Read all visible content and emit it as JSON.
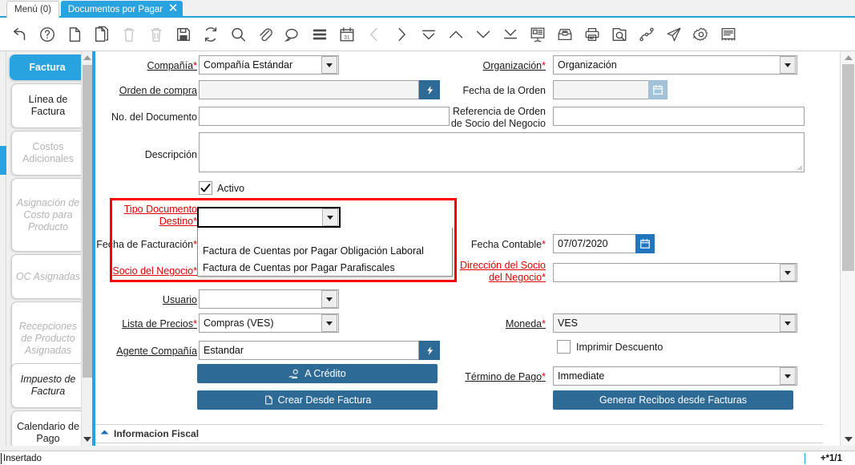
{
  "window": {
    "tabs": [
      {
        "label": "Menú (0)",
        "active": false,
        "closable": false
      },
      {
        "label": "Documentos por Pagar",
        "active": true,
        "closable": true
      }
    ]
  },
  "toolbar": {
    "buttons": [
      {
        "name": "undo-icon",
        "title": "Deshacer",
        "enabled": true
      },
      {
        "name": "help-icon",
        "title": "Ayuda",
        "enabled": true
      },
      {
        "name": "new-record-icon",
        "title": "Nuevo Registro",
        "enabled": true
      },
      {
        "name": "copy-record-icon",
        "title": "Copiar Registro",
        "enabled": true
      },
      {
        "name": "delete-icon",
        "title": "Eliminar",
        "enabled": false
      },
      {
        "name": "delete-selection-icon",
        "title": "Eliminar Selección",
        "enabled": false
      },
      {
        "name": "save-icon",
        "title": "Guardar Cambios",
        "enabled": true
      },
      {
        "name": "refresh-icon",
        "title": "Refrescar",
        "enabled": true
      },
      {
        "name": "search-icon",
        "title": "Buscar",
        "enabled": true
      },
      {
        "name": "attachment-icon",
        "title": "Adjunto",
        "enabled": true
      },
      {
        "name": "chat-icon",
        "title": "Nota de Registro",
        "enabled": true
      },
      {
        "name": "grid-toggle-icon",
        "title": "Cambiar Vista",
        "enabled": true
      },
      {
        "name": "calendar-icon",
        "title": "Solicitud",
        "enabled": true
      },
      {
        "name": "previous-record-icon",
        "title": "Registro Anterior",
        "enabled": false
      },
      {
        "name": "next-record-icon",
        "title": "Registro Siguiente",
        "enabled": true
      },
      {
        "name": "first-record-icon",
        "title": "Primer Registro",
        "enabled": true
      },
      {
        "name": "up-icon",
        "title": "Arriba",
        "enabled": true
      },
      {
        "name": "down-icon",
        "title": "Abajo",
        "enabled": true
      },
      {
        "name": "last-record-icon",
        "title": "Último Registro",
        "enabled": true
      },
      {
        "name": "report-icon",
        "title": "Reporte",
        "enabled": true
      },
      {
        "name": "archive-icon",
        "title": "Archivo",
        "enabled": true
      },
      {
        "name": "print-icon",
        "title": "Imprimir",
        "enabled": true
      },
      {
        "name": "zoom-across-icon",
        "title": "Acercar",
        "enabled": true
      },
      {
        "name": "workflow-icon",
        "title": "Flujo de Trabajo",
        "enabled": true
      },
      {
        "name": "send-icon",
        "title": "Enviar",
        "enabled": true
      },
      {
        "name": "settings-icon",
        "title": "Preferencia",
        "enabled": true
      },
      {
        "name": "ledger-icon",
        "title": "Registro Contable",
        "enabled": true
      }
    ]
  },
  "sidebar": {
    "items": [
      {
        "label": "Factura",
        "state": "selected"
      },
      {
        "label": "Línea de\nFactura",
        "state": "normal"
      },
      {
        "label": "Costos\nAdicionales",
        "state": "disabled"
      },
      {
        "label": "Asignación\nde Costo\npara\nProducto",
        "state": "disabled-italic"
      },
      {
        "label": "OC\nAsignadas",
        "state": "disabled-italic"
      },
      {
        "label": "Recepciones\nde\nProducto\nAsignadas",
        "state": "disabled-italic"
      },
      {
        "label": "Impuesto\nde Factura",
        "state": "italic"
      },
      {
        "label": "Calendario\nde Pago",
        "state": "normal"
      }
    ]
  },
  "form": {
    "compania": {
      "label": "Compañía",
      "required": true,
      "value": "Compañía Estándar"
    },
    "organizacion": {
      "label": "Organización",
      "required": true,
      "value": "Organización"
    },
    "orden_compra": {
      "label": "Orden de compra",
      "required": false,
      "value": ""
    },
    "fecha_orden": {
      "label": "Fecha de la Orden",
      "required": false,
      "value": ""
    },
    "no_documento": {
      "label": "No. del Documento",
      "required": false,
      "value": ""
    },
    "referencia_orden": {
      "label": "Referencia de Orden\nde Socio del Negocio",
      "required": false,
      "value": ""
    },
    "descripcion": {
      "label": "Descripción",
      "required": false,
      "value": ""
    },
    "activo": {
      "label": "Activo",
      "checked": true
    },
    "tipo_documento_destino": {
      "label": "Tipo Documento\nDestino",
      "required": true,
      "value": "",
      "open": true
    },
    "fecha_facturacion": {
      "label": "Fecha de Facturación",
      "required": true,
      "value": ""
    },
    "fecha_contable": {
      "label": "Fecha Contable",
      "required": true,
      "value": "07/07/2020"
    },
    "socio_negocio": {
      "label": "Socio del Negocio",
      "required": true,
      "value": ""
    },
    "direccion_socio": {
      "label": "Dirección del Socio\ndel Negocio",
      "required": true,
      "value": ""
    },
    "usuario": {
      "label": "Usuario",
      "required": false,
      "value": ""
    },
    "lista_precios": {
      "label": "Lista de Precios",
      "required": true,
      "value": "Compras (VES)"
    },
    "moneda": {
      "label": "Moneda",
      "required": true,
      "value": "VES"
    },
    "agente_compania": {
      "label": "Agente Compañía",
      "required": false,
      "value": "Estandar"
    },
    "imprimir_descuento": {
      "label": "Imprimir Descuento",
      "checked": false
    },
    "termino_pago": {
      "label": "Término de Pago",
      "required": true,
      "value": "Immediate"
    },
    "btn_a_credito": {
      "label": "A Crédito"
    },
    "btn_crear_desde_factura": {
      "label": "Crear Desde Factura"
    },
    "btn_generar_recibos": {
      "label": "Generar Recibos desde Facturas"
    },
    "section_fiscal": {
      "label": "Informacion Fiscal"
    }
  },
  "dropdown": {
    "options": [
      "Factura de Cuentas por Pagar Obligación Laboral",
      "Factura de Cuentas por Pagar Parafiscales"
    ]
  },
  "statusbar": {
    "left": "Insertado",
    "right": "+*1/1"
  },
  "colors": {
    "accent": "#29a3e0",
    "button": "#2e6a96",
    "required": "#e00000",
    "highlight": "#ff0000"
  }
}
